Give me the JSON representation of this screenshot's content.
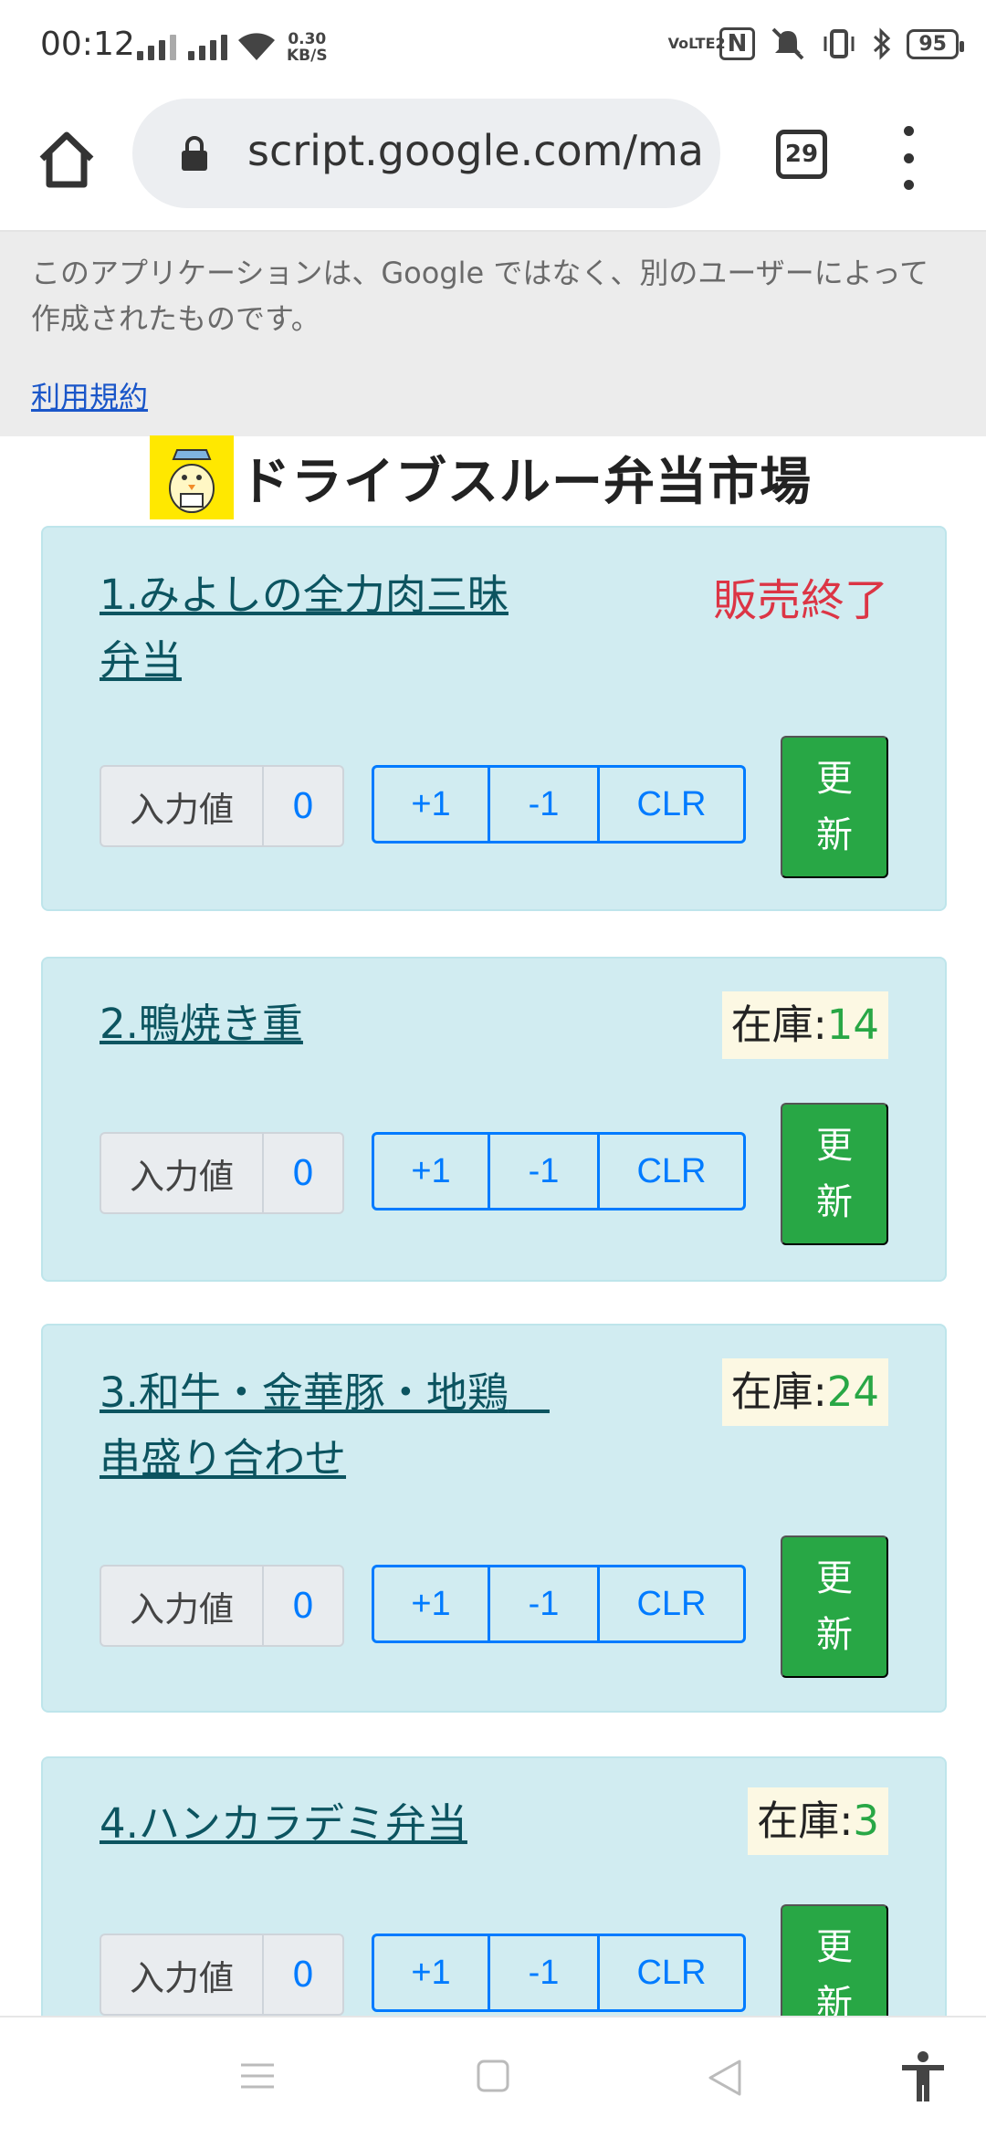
{
  "status_bar": {
    "time": "00:12",
    "speed_value": "0.30",
    "speed_unit": "KB/S",
    "volte": "VoLTE2",
    "nfc": "N",
    "battery": "95"
  },
  "browser": {
    "url": "script.google.com/macros",
    "tab_count": "29"
  },
  "banner": {
    "message": "このアプリケーションは、Google ではなく、別のユーザーによって作成されたものです。",
    "terms_link": "利用規約"
  },
  "page": {
    "title": "ドライブスルー弁当市場"
  },
  "labels": {
    "input_label": "入力値",
    "plus_one": "+1",
    "minus_one": "-1",
    "clear": "CLR",
    "update": "更新",
    "stock_prefix": "在庫:"
  },
  "items": [
    {
      "name": "1.みよしの全力肉三昧弁当",
      "status": "販売終了",
      "input_value": "0"
    },
    {
      "name": "2.鴨焼き重",
      "stock": "14",
      "input_value": "0"
    },
    {
      "name": "3.和牛・金華豚・地鶏　串盛り合わせ",
      "stock": "24",
      "input_value": "0"
    },
    {
      "name": "4.ハンカラデミ弁当",
      "stock": "3",
      "input_value": "0"
    }
  ],
  "colors": {
    "card_bg": "#d1ecf1",
    "sold_out": "#dc3545",
    "stock_number": "#28a745",
    "update_button": "#28a745",
    "primary": "#007bff"
  }
}
